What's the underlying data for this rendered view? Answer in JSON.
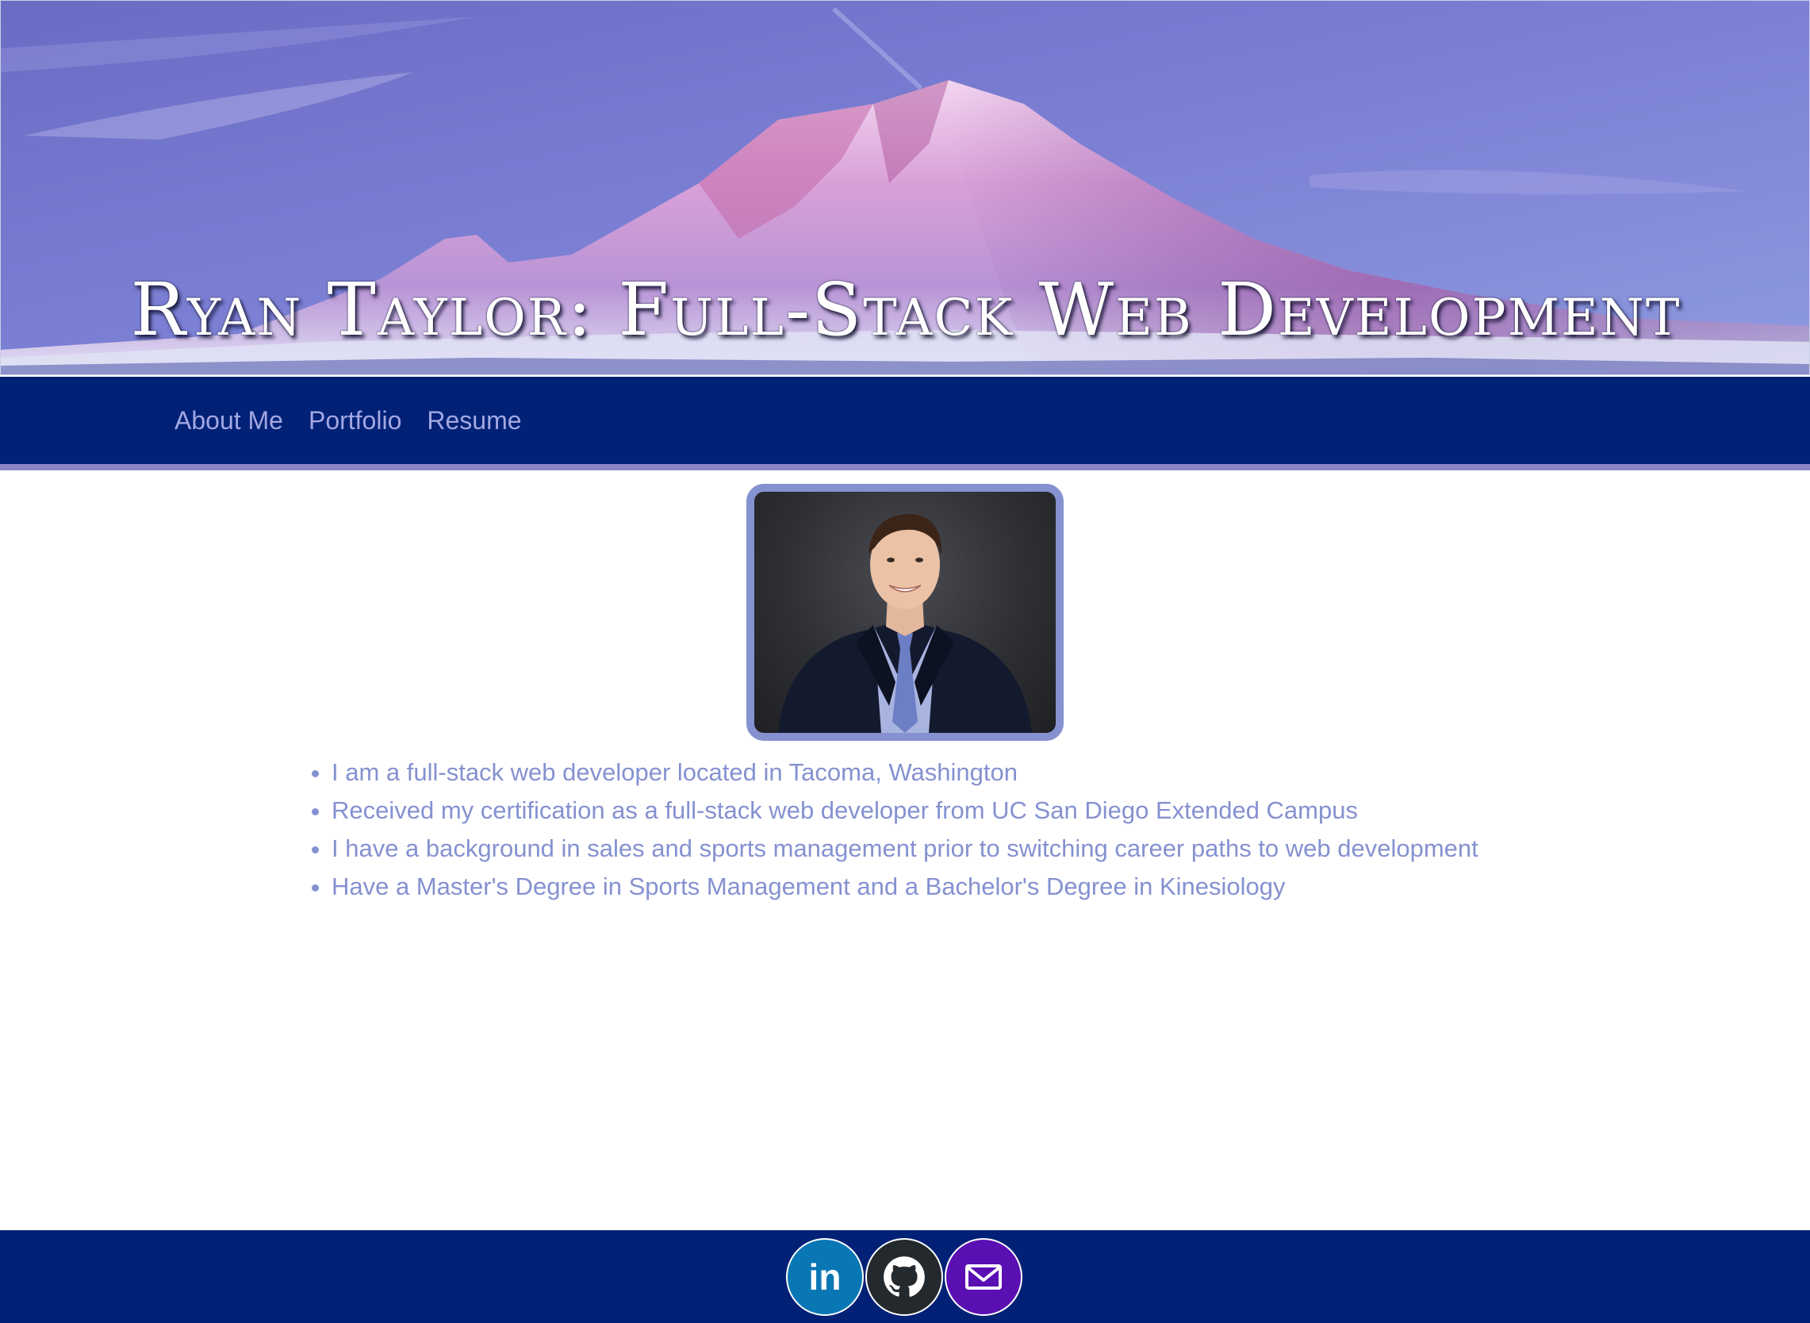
{
  "header": {
    "title": "Ryan Taylor: Full-Stack Web Development"
  },
  "nav": {
    "items": [
      {
        "label": "About Me"
      },
      {
        "label": "Portfolio"
      },
      {
        "label": "Resume"
      }
    ]
  },
  "about": {
    "bullets": [
      "I am a full-stack web developer located in Tacoma, Washington",
      "Received my certification as a full-stack web developer from UC San Diego Extended Campus",
      "I have a background in sales and sports management prior to switching career paths to web development",
      "Have a Master's Degree in Sports Management and a Bachelor's Degree in Kinesiology"
    ]
  },
  "footer": {
    "social": [
      {
        "icon": "linkedin-icon",
        "label": "in",
        "color": "#0a77b5"
      },
      {
        "icon": "github-icon",
        "color": "#24292e"
      },
      {
        "icon": "email-icon",
        "color": "#5a0fb3"
      }
    ]
  },
  "colors": {
    "nav_bg": "#002176",
    "accent": "#8591d0",
    "nav_border": "#8b84c8",
    "nav_text": "#a3a8e3"
  }
}
